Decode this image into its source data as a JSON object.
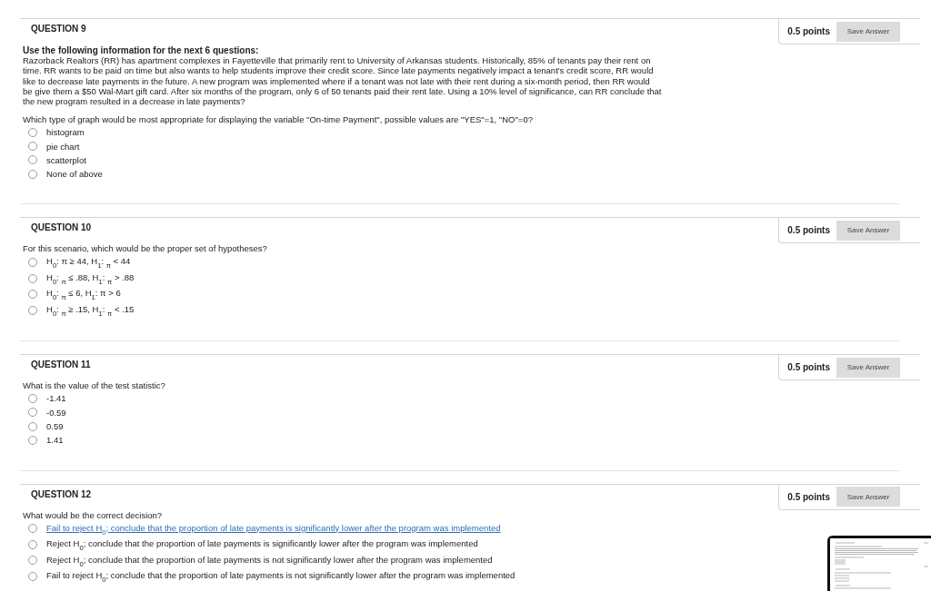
{
  "questions": [
    {
      "title": "QUESTION 9",
      "points": "0.5 points",
      "save_button": "Save Answer",
      "intro_heading": "Use the following information for the next 6 questions:",
      "intro": "Razorback Realtors (RR) has apartment complexes in Fayetteville that primarily rent to University of Arkansas students. Historically, 85% of tenants pay their rent on\ntime. RR wants to be paid on time but also wants to help students improve their credit score. Since late payments negatively impact a tenant's credit score, RR would\nlike to decrease late payments in the future. A new program was implemented where if a tenant was not late with their rent during a six-month period, then RR would\nbe give them a $50 Wal-Mart gift card. After six months of the program, only 6 of 50 tenants paid their rent late. Using a 10% level of significance, can RR conclude that\nthe new program resulted in a decrease in late payments?",
      "prompt": "Which type of graph would be most appropriate for displaying the variable \"On-time Payment\", possible values are \"YES\"=1, \"NO\"=0?",
      "options": [
        {
          "text": "histogram",
          "selected": false
        },
        {
          "text": "pie chart",
          "selected": false
        },
        {
          "text": "scatterplot",
          "selected": false
        },
        {
          "text": "None of above",
          "selected": false
        }
      ]
    },
    {
      "title": "QUESTION 10",
      "points": "0.5 points",
      "save_button": "Save Answer",
      "prompt": "For this scenario, which would be the proper set of hypotheses?",
      "options": [
        {
          "text": "H$_{0}$: π ≥ 44, H$_{1}$: $_{π}$ < 44",
          "selected": false
        },
        {
          "text": "H$_{0}$: $_{π}$ ≤ .88, H$_{1}$: $_{π}$ > .88",
          "selected": false
        },
        {
          "text": "H$_{0}$: $_{π}$ ≤ 6, H$_{1}$: π > 6",
          "selected": false
        },
        {
          "text": "H$_{0}$: $_{π}$ ≥ .15, H$_{1}$: $_{π}$ < .15",
          "selected": false
        }
      ]
    },
    {
      "title": "QUESTION 11",
      "points": "0.5 points",
      "save_button": "Save Answer",
      "prompt": "What is the value of the test statistic?",
      "options": [
        {
          "text": "-1.41",
          "selected": false
        },
        {
          "text": "-0.59",
          "selected": false
        },
        {
          "text": "0.59",
          "selected": false
        },
        {
          "text": "1.41",
          "selected": false
        }
      ]
    },
    {
      "title": "QUESTION 12",
      "points": "0.5 points",
      "save_button": "Save Answer",
      "prompt": "What would be the correct decision?",
      "options": [
        {
          "text": "Fail to reject H$_{0}$; conclude that the proportion of late payments is significantly lower after the program was implemented",
          "selected": false,
          "highlighted": true
        },
        {
          "text": "Reject H$_{0}$; conclude that the proportion of late payments is significantly lower after the program was implemented",
          "selected": false,
          "highlighted": false
        },
        {
          "text": "Reject H$_{0}$; conclude that the proportion of late payments is not significantly lower after the program was implemented",
          "selected": false,
          "highlighted": false
        },
        {
          "text": "Fail to reject H$_{0}$; conclude that the proportion of late payments is not significantly lower after the program was implemented",
          "selected": false,
          "highlighted": false
        }
      ]
    }
  ]
}
